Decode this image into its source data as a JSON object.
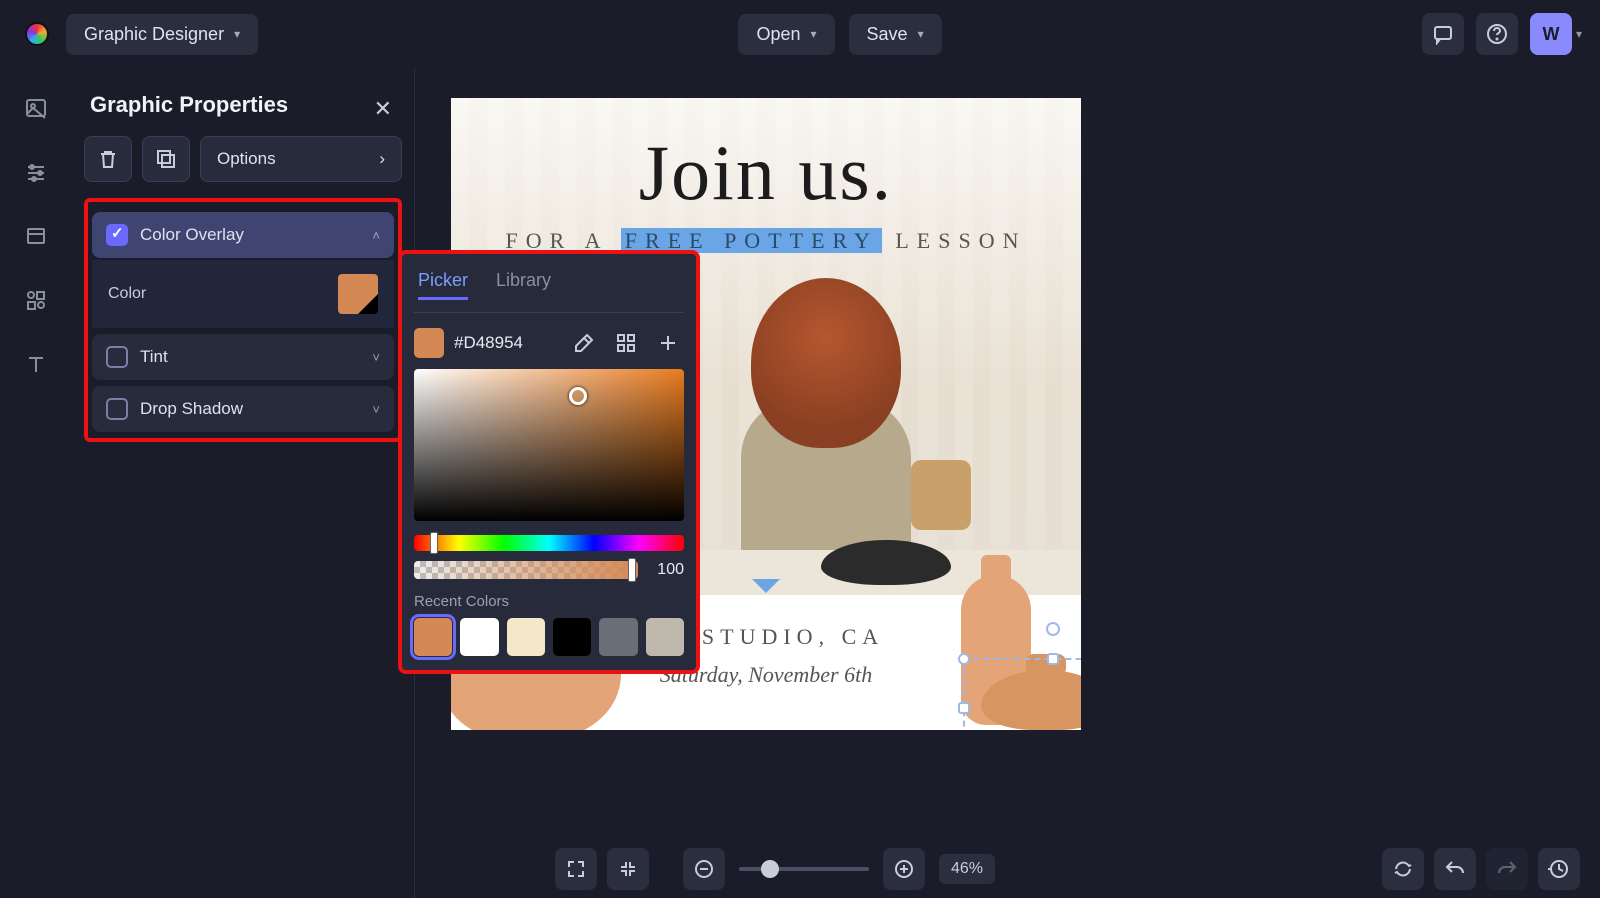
{
  "topbar": {
    "mode": "Graphic Designer",
    "open": "Open",
    "save": "Save",
    "avatar": "W"
  },
  "sidebar": {
    "title": "Graphic Properties",
    "options": "Options",
    "props": {
      "color_overlay": "Color Overlay",
      "color_label": "Color",
      "tint": "Tint",
      "drop_shadow": "Drop Shadow"
    }
  },
  "picker": {
    "tabs": {
      "picker": "Picker",
      "library": "Library"
    },
    "hex": "#D48954",
    "alpha": "100",
    "recent_label": "Recent Colors",
    "recent": [
      "#d48954",
      "#ffffff",
      "#f3e8c8",
      "#000000",
      "#6a6e76",
      "#bfb9ad"
    ]
  },
  "canvas": {
    "headline": "Join us.",
    "subline_pre": "FOR A ",
    "subline_hl": "FREE POTTERY",
    "subline_post": " LESSON",
    "loc": "NA STUDIO, CA",
    "date": "Saturday, November 6th",
    "zoom": "46%"
  }
}
